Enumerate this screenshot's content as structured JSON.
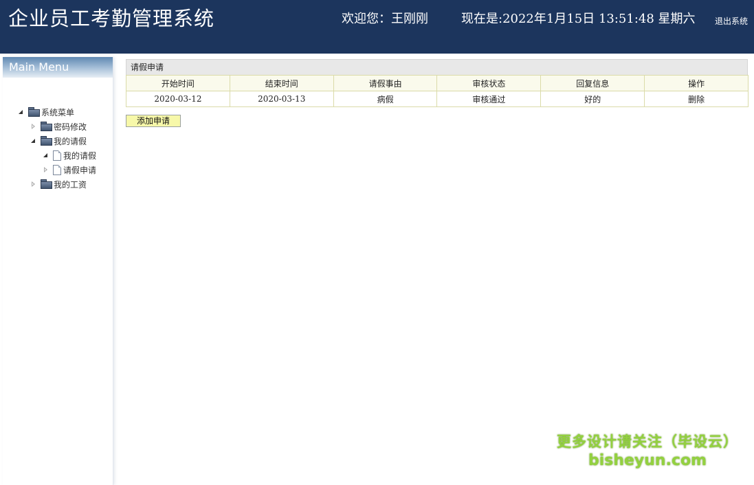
{
  "header": {
    "title": "企业员工考勤管理系统",
    "welcome_label": "欢迎您：",
    "user_name": "王刚刚",
    "now_label": "现在是:",
    "datetime": "2022年1月15日 13:51:48 星期六",
    "logout_label": "退出系统",
    "bg_color": "#1c355d"
  },
  "sidebar": {
    "heading": "Main Menu",
    "tree": {
      "root": {
        "label": "系统菜单",
        "icon": "folder-icon",
        "expanded": true
      },
      "password": {
        "label": "密码修改",
        "icon": "folder-icon",
        "expanded": false
      },
      "my_leave": {
        "label": "我的请假",
        "icon": "folder-icon",
        "expanded": true
      },
      "my_leave_list": {
        "label": "我的请假",
        "icon": "page-icon",
        "expanded": true
      },
      "leave_apply": {
        "label": "请假申请",
        "icon": "page-icon",
        "expanded": false
      },
      "my_salary": {
        "label": "我的工资",
        "icon": "folder-icon",
        "expanded": false
      }
    }
  },
  "main": {
    "panel_title": "请假申请",
    "columns": [
      "开始时间",
      "结束时间",
      "请假事由",
      "审核状态",
      "回复信息",
      "操作"
    ],
    "rows": [
      {
        "start": "2020-03-12",
        "end": "2020-03-13",
        "reason": "病假",
        "status": "审核通过",
        "reply": "好的",
        "action": "删除"
      }
    ],
    "add_button": "添加申请"
  },
  "watermark": {
    "line1": "更多设计请关注（毕设云）",
    "line2": "bisheyun.com"
  }
}
